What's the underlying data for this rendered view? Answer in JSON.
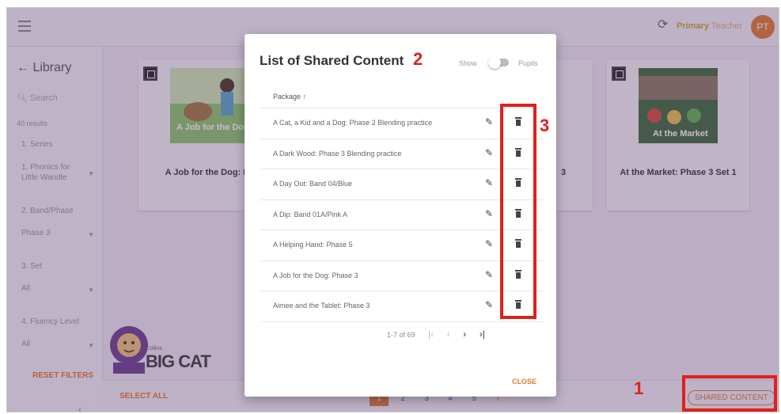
{
  "header": {
    "menu_icon": "hamburger-icon",
    "refresh_icon": "refresh-icon",
    "role_primary": "Primary",
    "role_suffix": "Teacher",
    "avatar_initials": "PT"
  },
  "sidebar": {
    "title": "Library",
    "back_icon": "arrow-left-icon",
    "search_placeholder": "Search",
    "results": "40 results",
    "filters": [
      {
        "label": "1. Series",
        "value": "1. Phonics for Little Wandle"
      },
      {
        "label": "2. Band/Phase",
        "value": "Phase 3"
      },
      {
        "label": "3. Set",
        "value": "All"
      },
      {
        "label": "4. Fluency Level",
        "value": "All"
      }
    ],
    "reset_label": "RESET FILTERS",
    "collapse_icon": "chevron-left-icon"
  },
  "cards": [
    {
      "title": "A Job for the Dog: Ph",
      "cover_text": "A Job for the Dog"
    },
    {
      "title": "3",
      "cover_text": ""
    },
    {
      "title": "At the Market: Phase 3 Set 1",
      "cover_text": "At the Market"
    }
  ],
  "brand": {
    "small": "Collins",
    "name": "BIG CAT"
  },
  "bottombar": {
    "select_all": "SELECT ALL",
    "pages": [
      "1",
      "2",
      "3",
      "4",
      "5"
    ],
    "active_page": "1",
    "next": "›",
    "shared_content": "SHARED CONTENT"
  },
  "modal": {
    "title": "List of Shared Content",
    "show_label": "Show",
    "toggle_label": "Pupils",
    "column_header": "Package ↑",
    "rows": [
      "A Cat, a Kid and a Dog: Phase 2 Blending practice",
      "A Dark Wood: Phase 3 Blending practice",
      "A Day Out: Band 04/Blue",
      "A Dip: Band 01A/Pink A",
      "A Helping Hand: Phase 5",
      "A Job for the Dog: Phase 3",
      "Aimee and the Tablet: Phase 3"
    ],
    "pagination_text": "1-7 of 69",
    "first_icon": "|‹",
    "prev_icon": "‹",
    "next_icon": "›",
    "last_icon": "›|",
    "close_label": "CLOSE"
  },
  "annotations": {
    "one": "1",
    "two": "2",
    "three": "3",
    "color": "#e0201a"
  }
}
